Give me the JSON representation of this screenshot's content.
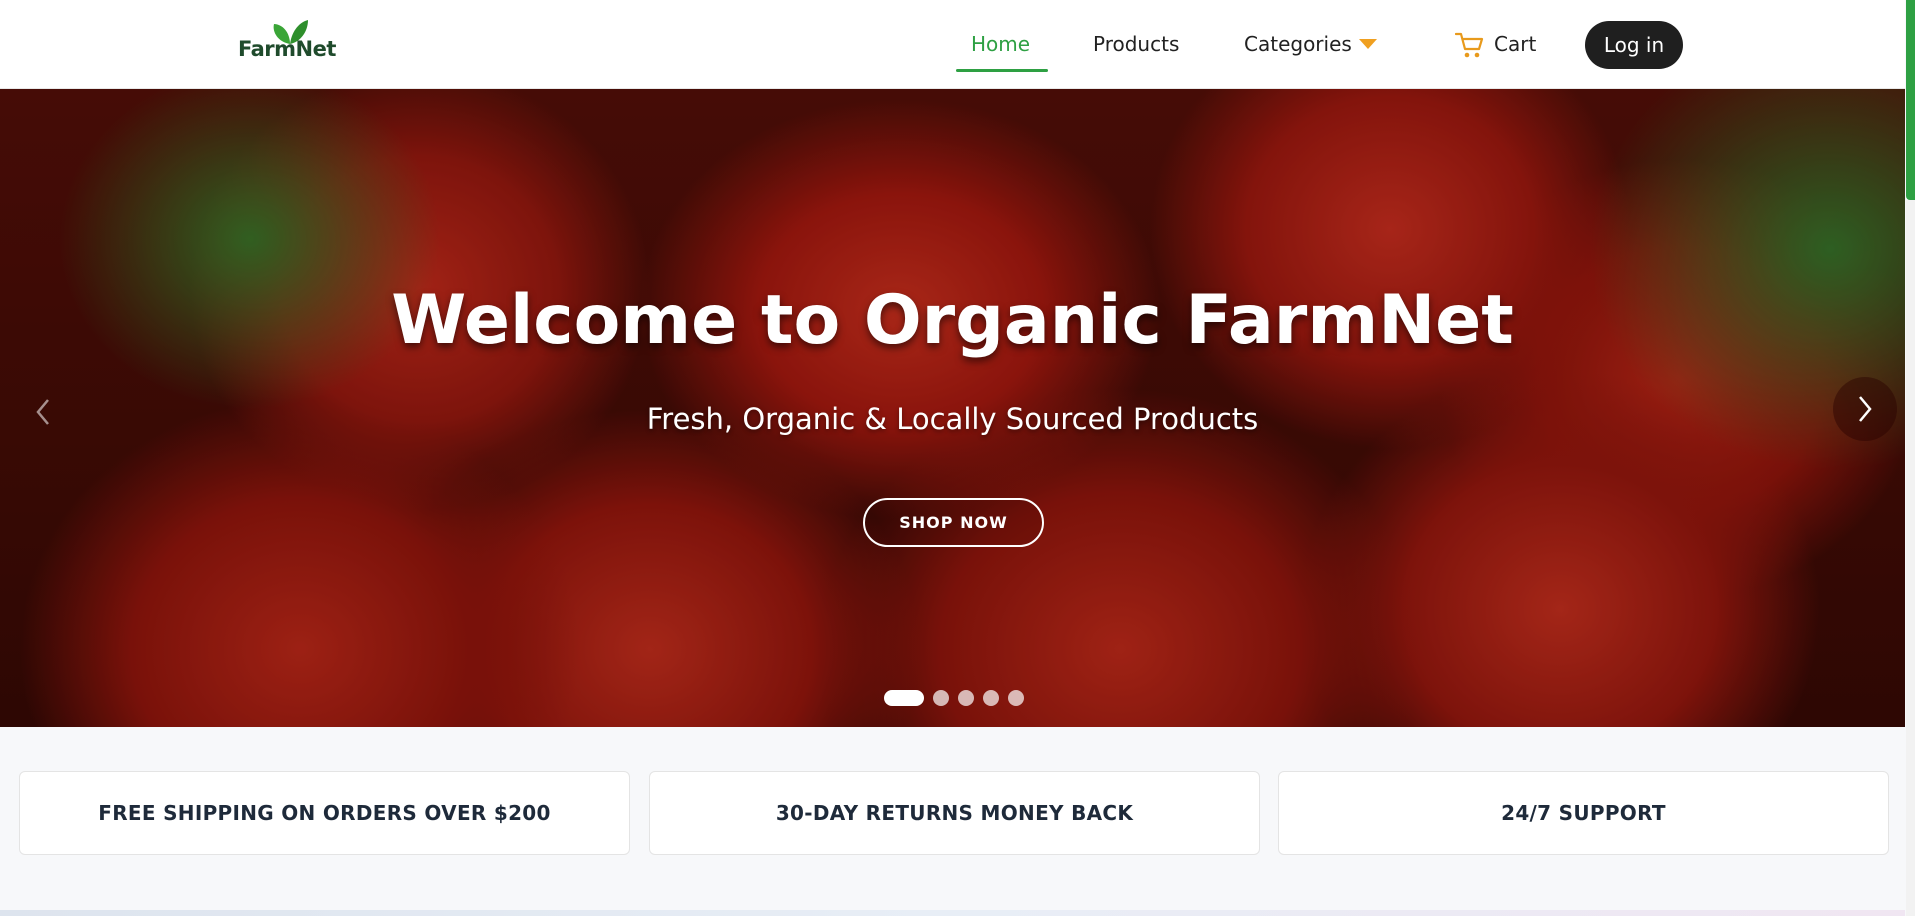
{
  "brand": {
    "logo_text": "FarmNet",
    "accent_color": "#2ea043",
    "arrow_color": "#f0a020"
  },
  "nav": {
    "home": "Home",
    "products": "Products",
    "categories": "Categories",
    "cart": "Cart",
    "login": "Log in"
  },
  "hero": {
    "title": "Welcome to Organic FarmNet",
    "subtitle": "Fresh, Organic & Locally Sourced Products",
    "cta": "SHOP NOW",
    "slide_count": 5,
    "active_slide": 1
  },
  "features": [
    "FREE SHIPPING ON ORDERS OVER $200",
    "30-DAY RETURNS MONEY BACK",
    "24/7 SUPPORT"
  ]
}
